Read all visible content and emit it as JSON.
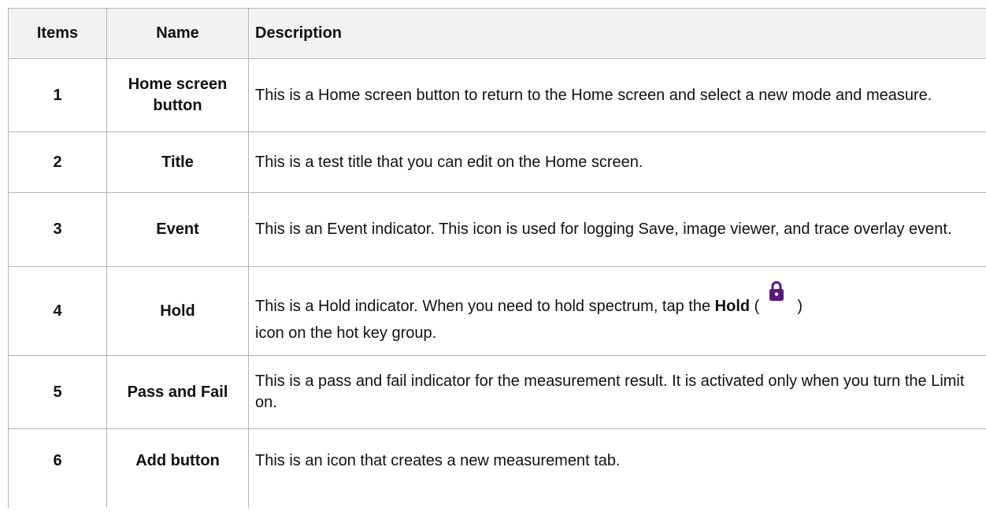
{
  "table": {
    "headers": {
      "items": "Items",
      "name": "Name",
      "description": "Description"
    },
    "rows": [
      {
        "item": "1",
        "name": "Home screen button",
        "description": "This is a Home screen button to return to the Home screen and select a new mode and measure."
      },
      {
        "item": "2",
        "name": "Title",
        "description": "This is a test title that you can edit on the Home screen."
      },
      {
        "item": "3",
        "name": "Event",
        "description": "This is an Event indicator. This icon is used for logging Save, image viewer, and trace overlay event."
      },
      {
        "item": "4",
        "name": "Hold",
        "description_before": "This is a Hold indicator. When you need to hold spectrum, tap the ",
        "description_bold": "Hold",
        "description_paren_open": " (",
        "description_paren_close": ")",
        "description_after": "icon on the hot key group."
      },
      {
        "item": "5",
        "name": "Pass and Fail",
        "description": "This is a pass and fail indicator for the measurement result. It is activated only when you turn the Limit on."
      },
      {
        "item": "6",
        "name": "Add button",
        "description": "This is an icon that creates a new measurement tab."
      }
    ]
  },
  "icons": {
    "hold": "lock-icon",
    "hold_color": "#5b1a7a"
  }
}
